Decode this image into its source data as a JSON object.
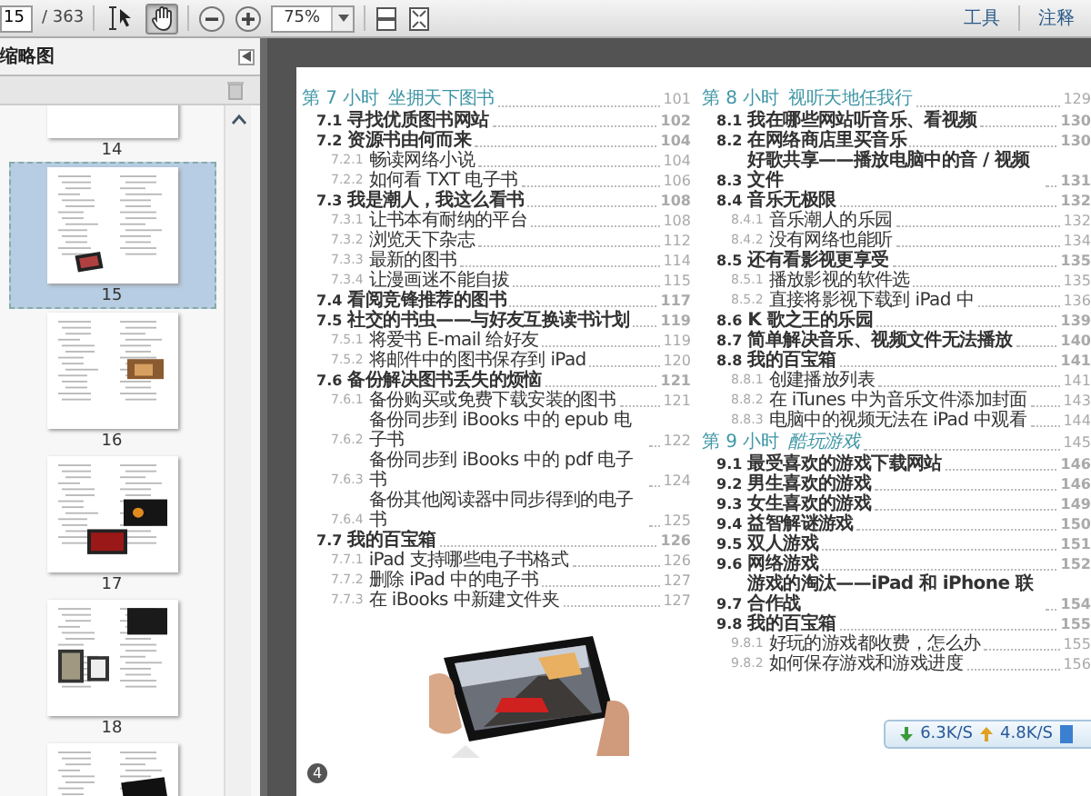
{
  "toolbar": {
    "page_field": "15",
    "page_count": "/ 363",
    "tools": [
      {
        "kind": "select",
        "selected": false
      },
      {
        "kind": "hand",
        "selected": true
      }
    ],
    "zoom": "75%",
    "links": [
      "工具",
      "注释"
    ]
  },
  "sidebar": {
    "title": "缩略图",
    "thumbnails": [
      {
        "label": "14",
        "selected": false,
        "kind": "cut-top"
      },
      {
        "label": "15",
        "selected": true,
        "kind": "toc-photo"
      },
      {
        "label": "16",
        "selected": false,
        "kind": "toc-inset"
      },
      {
        "label": "17",
        "selected": false,
        "kind": "tablets"
      },
      {
        "label": "18",
        "selected": false,
        "kind": "tablets-left"
      },
      {
        "selected": false,
        "kind": "cut-bottom"
      }
    ]
  },
  "document": {
    "columns": [
      {
        "entries": [
          {
            "kind": "chapter",
            "number": "第 7 小时",
            "title": "坐拥天下图书",
            "italic": false,
            "page": "101"
          },
          {
            "kind": "section",
            "number": "7.1",
            "title": "寻找优质图书网站",
            "page": "102"
          },
          {
            "kind": "section",
            "number": "7.2",
            "title": "资源书由何而来",
            "page": "104"
          },
          {
            "kind": "sub",
            "number": "7.2.1",
            "title": "畅读网络小说",
            "page": "104"
          },
          {
            "kind": "sub",
            "number": "7.2.2",
            "title": "如何看 TXT 电子书",
            "page": "106"
          },
          {
            "kind": "section",
            "number": "7.3",
            "title": "我是潮人，我这么看书",
            "page": "108"
          },
          {
            "kind": "sub",
            "number": "7.3.1",
            "title": "让书本有耐纳的平台",
            "page": "108"
          },
          {
            "kind": "sub",
            "number": "7.3.2",
            "title": "浏览天下杂志",
            "page": "112"
          },
          {
            "kind": "sub",
            "number": "7.3.3",
            "title": "最新的图书",
            "page": "114"
          },
          {
            "kind": "sub",
            "number": "7.3.4",
            "title": "让漫画迷不能自拔",
            "page": "115"
          },
          {
            "kind": "section",
            "number": "7.4",
            "title": "看阅竞锋推荐的图书",
            "page": "117"
          },
          {
            "kind": "section",
            "number": "7.5",
            "title": "社交的书虫——与好友互换读书计划",
            "page": "119"
          },
          {
            "kind": "sub",
            "number": "7.5.1",
            "title": "将爱书 E-mail 给好友",
            "page": "119"
          },
          {
            "kind": "sub",
            "number": "7.5.2",
            "title": "将邮件中的图书保存到 iPad",
            "page": "120"
          },
          {
            "kind": "section",
            "number": "7.6",
            "title": "备份解决图书丢失的烦恼",
            "page": "121"
          },
          {
            "kind": "sub",
            "number": "7.6.1",
            "title": "备份购买或免费下载安装的图书",
            "page": "121"
          },
          {
            "kind": "sub",
            "number": "7.6.2",
            "title": "备份同步到 iBooks 中的 epub 电子书",
            "page": "122"
          },
          {
            "kind": "sub",
            "number": "7.6.3",
            "title": "备份同步到 iBooks 中的 pdf 电子书",
            "page": "124"
          },
          {
            "kind": "sub",
            "number": "7.6.4",
            "title": "备份其他阅读器中同步得到的电子书",
            "page": "125"
          },
          {
            "kind": "section",
            "number": "7.7",
            "title": "我的百宝箱",
            "page": "126"
          },
          {
            "kind": "sub",
            "number": "7.7.1",
            "title": "iPad 支持哪些电子书格式",
            "page": "126"
          },
          {
            "kind": "sub",
            "number": "7.7.2",
            "title": "删除 iPad 中的电子书",
            "page": "127"
          },
          {
            "kind": "sub",
            "number": "7.7.3",
            "title": "在 iBooks 中新建文件夹",
            "page": "127"
          }
        ]
      },
      {
        "entries": [
          {
            "kind": "chapter",
            "number": "第 8 小时",
            "title": "视听天地任我行",
            "italic": false,
            "page": "129"
          },
          {
            "kind": "section",
            "number": "8.1",
            "title": "我在哪些网站听音乐、看视频",
            "page": "130"
          },
          {
            "kind": "section",
            "number": "8.2",
            "title": "在网络商店里买音乐",
            "page": "130"
          },
          {
            "kind": "section",
            "number": "8.3",
            "title": "好歌共享——播放电脑中的音 / 视频文件",
            "page": "131"
          },
          {
            "kind": "section",
            "number": "8.4",
            "title": "音乐无极限",
            "page": "132"
          },
          {
            "kind": "sub",
            "number": "8.4.1",
            "title": "音乐潮人的乐园",
            "page": "132"
          },
          {
            "kind": "sub",
            "number": "8.4.2",
            "title": "没有网络也能听",
            "page": "134"
          },
          {
            "kind": "section",
            "number": "8.5",
            "title": "还有看影视更享受",
            "page": "135"
          },
          {
            "kind": "sub",
            "number": "8.5.1",
            "title": "播放影视的软件选",
            "page": "135"
          },
          {
            "kind": "sub",
            "number": "8.5.2",
            "title": "直接将影视下载到 iPad 中",
            "page": "136"
          },
          {
            "kind": "section",
            "number": "8.6",
            "title": "K 歌之王的乐园",
            "page": "139"
          },
          {
            "kind": "section",
            "number": "8.7",
            "title": "简单解决音乐、视频文件无法播放",
            "page": "140"
          },
          {
            "kind": "section",
            "number": "8.8",
            "title": "我的百宝箱",
            "page": "141"
          },
          {
            "kind": "sub",
            "number": "8.8.1",
            "title": "创建播放列表",
            "page": "141"
          },
          {
            "kind": "sub",
            "number": "8.8.2",
            "title": "在 iTunes 中为音乐文件添加封面",
            "page": "143"
          },
          {
            "kind": "sub",
            "number": "8.8.3",
            "title": "电脑中的视频无法在 iPad 中观看",
            "page": "144"
          },
          {
            "kind": "chapter",
            "number": "第 9 小时",
            "title": "酷玩游戏",
            "italic": true,
            "page": "145"
          },
          {
            "kind": "section",
            "number": "9.1",
            "title": "最受喜欢的游戏下载网站",
            "page": "146"
          },
          {
            "kind": "section",
            "number": "9.2",
            "title": "男生喜欢的游戏",
            "page": "146"
          },
          {
            "kind": "section",
            "number": "9.3",
            "title": "女生喜欢的游戏",
            "page": "149"
          },
          {
            "kind": "section",
            "number": "9.4",
            "title": "益智解谜游戏",
            "page": "150"
          },
          {
            "kind": "section",
            "number": "9.5",
            "title": "双人游戏",
            "page": "151"
          },
          {
            "kind": "section",
            "number": "9.6",
            "title": "网络游戏",
            "page": "152"
          },
          {
            "kind": "section",
            "number": "9.7",
            "title": "游戏的淘汰——iPad 和 iPhone 联合作战",
            "page": "154"
          },
          {
            "kind": "section",
            "number": "9.8",
            "title": "我的百宝箱",
            "page": "155"
          },
          {
            "kind": "sub",
            "number": "9.8.1",
            "title": "好玩的游戏都收费，怎么办",
            "page": "155"
          },
          {
            "kind": "sub",
            "number": "9.8.2",
            "title": "如何保存游戏和游戏进度",
            "page": "156"
          }
        ]
      }
    ],
    "page_number": "4"
  },
  "speed_widget": {
    "download": "6.3K/S",
    "upload": "4.8K/S"
  }
}
